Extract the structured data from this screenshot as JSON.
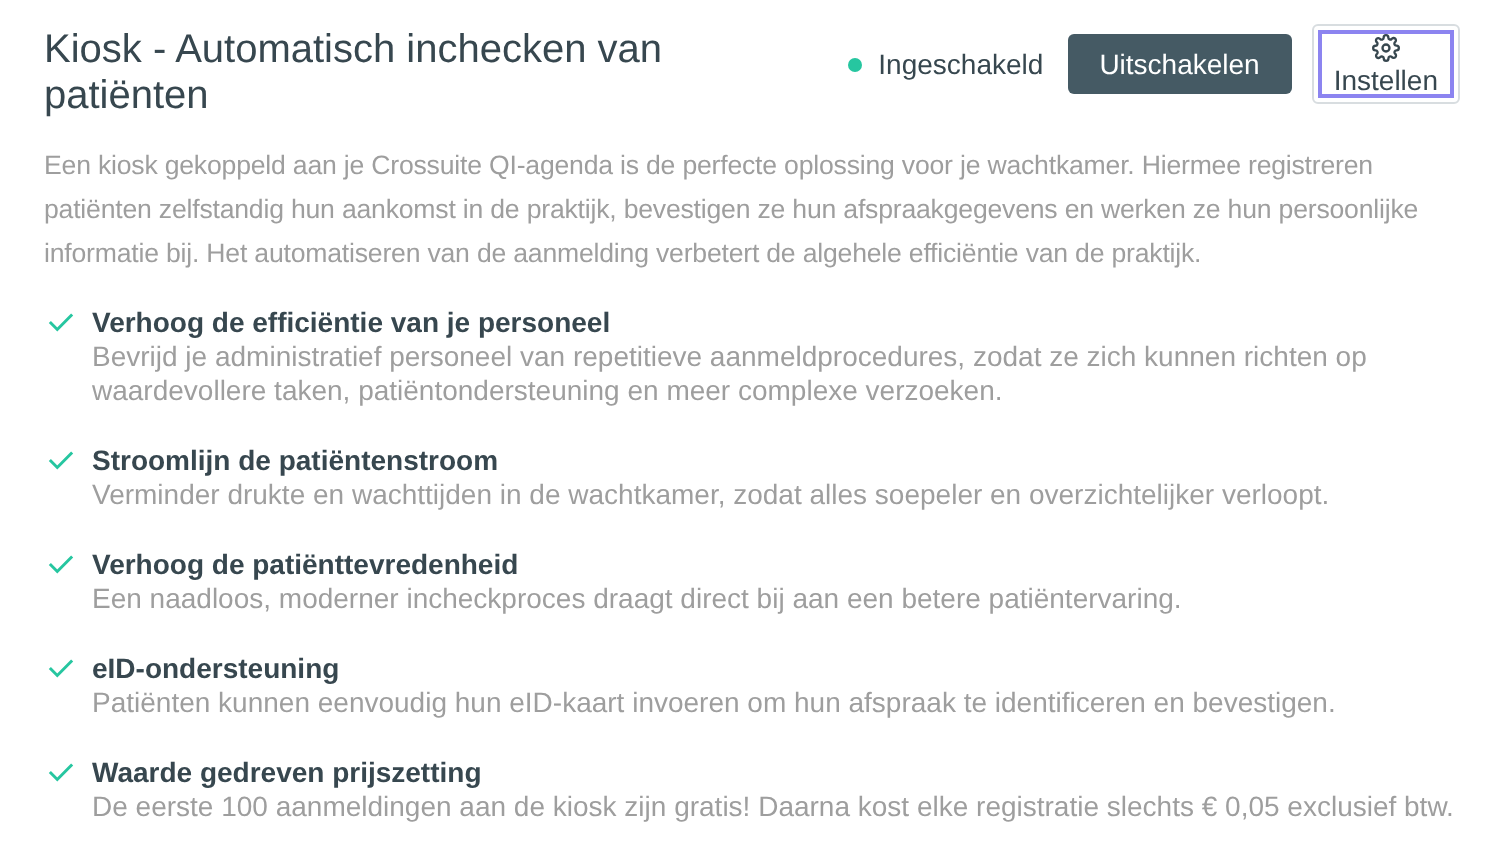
{
  "header": {
    "title": "Kiosk - Automatisch inchecken van patiënten",
    "status": {
      "label": "Ingeschakeld",
      "on": true,
      "color": "#26c6a0"
    },
    "buttons": [
      {
        "kind": "primary",
        "label": "Uitschakelen"
      },
      {
        "kind": "settings",
        "label": "Instellen",
        "focused": true
      }
    ]
  },
  "intro": "Een kiosk gekoppeld aan je Crossuite QI-agenda is de perfecte oplossing voor je wachtkamer. Hiermee registreren patiënten zelfstandig hun aankomst in de praktijk, bevestigen ze hun afspraakgegevens en werken ze hun persoonlijke informatie bij. Het automatiseren van de aanmelding verbetert de algehele efficiëntie van de praktijk.",
  "features": [
    {
      "title": "Verhoog de efficiëntie van je personeel",
      "description": "Bevrijd je administratief personeel van repetitieve aanmeldprocedures, zodat ze zich kunnen richten op waardevollere taken, patiëntondersteuning en meer complexe verzoeken."
    },
    {
      "title": "Stroomlijn de patiëntenstroom",
      "description": "Verminder drukte en wachttijden in de wachtkamer, zodat alles soepeler en overzichtelijker verloopt."
    },
    {
      "title": "Verhoog de patiënttevredenheid",
      "description": "Een naadloos, moderner incheckproces draagt direct bij aan een betere patiëntervaring."
    },
    {
      "title": "eID-ondersteuning",
      "description": "Patiënten kunnen eenvoudig hun eID-kaart invoeren om hun afspraak te identificeren en bevestigen."
    },
    {
      "title": "Waarde gedreven prijszetting",
      "description": "De eerste 100 aanmeldingen aan de kiosk zijn gratis! Daarna kost elke registratie slechts € 0,05 exclusief btw."
    }
  ]
}
